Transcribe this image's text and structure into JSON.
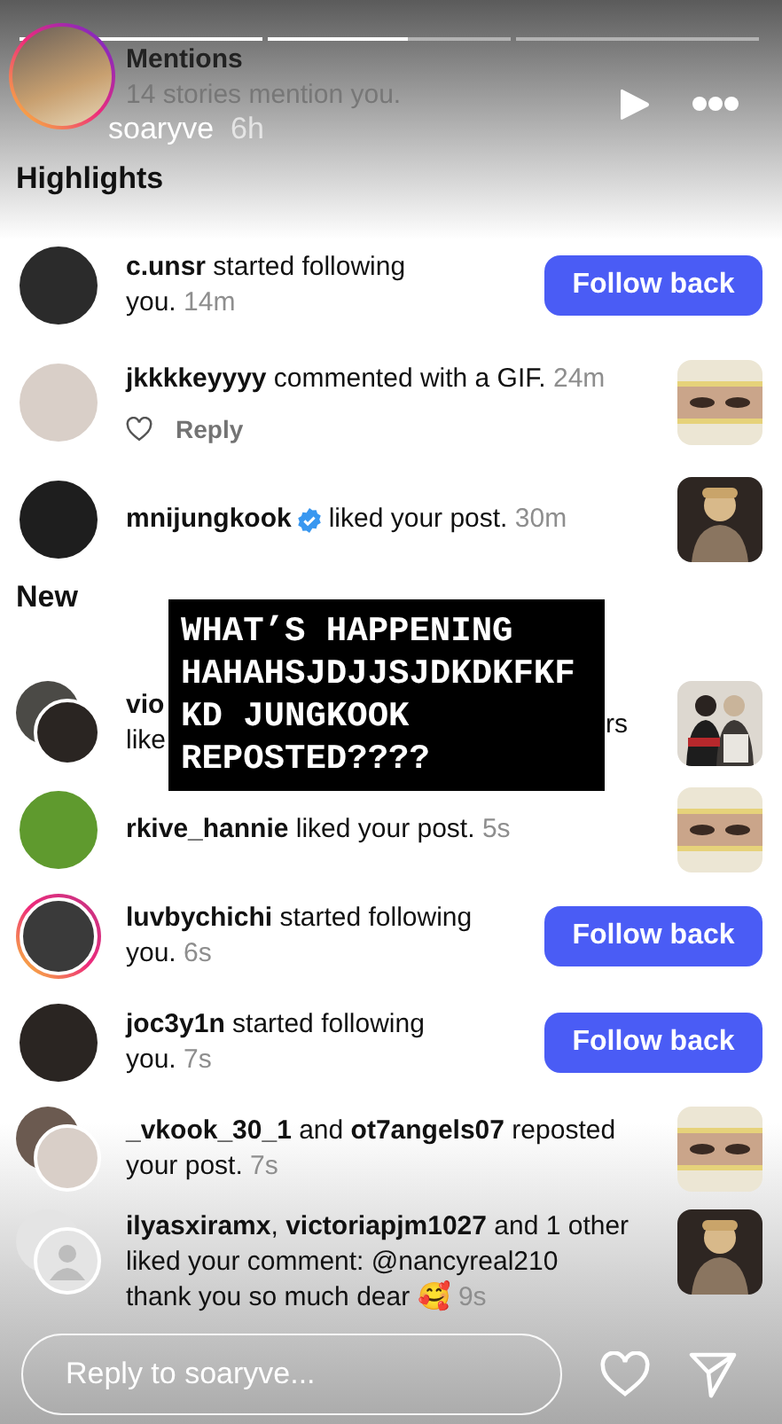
{
  "story": {
    "progress": [
      {
        "kind": "seen",
        "level": 1
      },
      {
        "kind": "current",
        "level": 0.58
      },
      {
        "kind": "unseen"
      }
    ],
    "ring": true,
    "user": "soaryve",
    "time": "6h"
  },
  "mentions": {
    "title": "Mentions",
    "subtitle": "14 stories mention you."
  },
  "sections": [
    {
      "title": "Highlights",
      "rows": [
        {
          "kind": "follow",
          "avatar": {
            "kind": "plain"
          },
          "verified": false,
          "text": "**c.unsr** started following\nyou.",
          "time": "14m",
          "action": "Follow back"
        },
        {
          "kind": "comment",
          "avatar": {
            "kind": "plain"
          },
          "verified": false,
          "text": "**jkkkkeyyyy** commented with a GIF.",
          "time": "24m",
          "reply": "Reply"
        },
        {
          "kind": "post",
          "avatar": {
            "kind": "plain"
          },
          "verified": true,
          "user": "mnijungkook",
          "text": "liked your post.",
          "time": "30m"
        }
      ]
    },
    {
      "title": "New",
      "rows": [
        {
          "kind": "post",
          "avatar": {
            "kind": "pair"
          },
          "verified": false,
          "text": "**vio**\nlike",
          "tail": "rs"
        },
        {
          "kind": "post",
          "avatar": {
            "kind": "plain"
          },
          "verified": false,
          "text": "**rkive_hannie** liked your post.",
          "time": "5s"
        },
        {
          "kind": "follow",
          "avatar": {
            "kind": "story"
          },
          "verified": false,
          "text": "**luvbychichi** started following\nyou.",
          "time": "6s",
          "action": "Follow back"
        },
        {
          "kind": "follow",
          "avatar": {
            "kind": "plain"
          },
          "verified": false,
          "text": "**joc3y1n** started following\nyou.",
          "time": "7s",
          "action": "Follow back"
        },
        {
          "kind": "post",
          "avatar": {
            "kind": "pair"
          },
          "verified": false,
          "text": "**_vkook_30_1** and **ot7angels07** reposted\nyour post.",
          "time": "7s"
        },
        {
          "kind": "post",
          "avatar": {
            "kind": "pair_placeholder"
          },
          "verified": false,
          "text": "**ilyasxiramx**, **victoriapjm1027** and 1 other\nliked your comment: @nancyreal210\nthank you so much dear 🥰",
          "time": "9s"
        }
      ]
    }
  ],
  "sticker": {
    "text": "WHAT’S HAPPENING\nHAHAHSJDJJSJDKDKFKF\nKD JUNGKOOK\nREPOSTED????"
  },
  "reply_field": {
    "placeholder": "Reply to soaryve..."
  }
}
